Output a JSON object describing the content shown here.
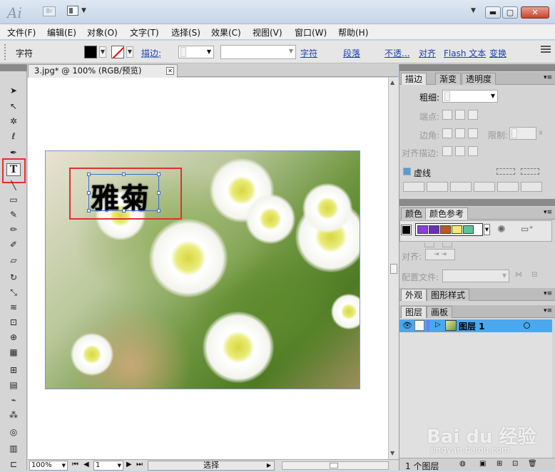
{
  "app": {
    "logo": "Ai",
    "bridge_label": "Br",
    "window_buttons": {
      "minimize": "▬",
      "maximize": "▢",
      "close": "✕"
    }
  },
  "menu": [
    "文件(F)",
    "编辑(E)",
    "对象(O)",
    "文字(T)",
    "选择(S)",
    "效果(C)",
    "视图(V)",
    "窗口(W)",
    "帮助(H)"
  ],
  "control_bar": {
    "mode_label": "字符",
    "stroke_label": "描边:",
    "links": [
      "字符",
      "段落",
      "不透...",
      "对齐",
      "Flash 文本",
      "变换"
    ]
  },
  "document": {
    "tab_title": "3.jpg* @ 100% (RGB/预览)",
    "artwork_text": "雅菊"
  },
  "status_bar": {
    "zoom": "100%",
    "page": "1",
    "tool": "选择"
  },
  "stroke_panel": {
    "tabs": [
      "描边",
      "渐变",
      "透明度"
    ],
    "weight_label": "粗细:",
    "cap_label": "端点:",
    "corner_label": "边角:",
    "limit_label": "限制:",
    "align_label": "对齐描边:",
    "dashed_label": "虚线",
    "limit_unit": "x"
  },
  "color_panel": {
    "tabs": [
      "颜色",
      "颜色参考"
    ],
    "align_label": "对齐:",
    "profile_label": "配置文件:",
    "harmony_colors": [
      "#8a3fd8",
      "#6a2fb8",
      "#c0571e",
      "#f2ea72",
      "#59c596"
    ]
  },
  "appearance_panel": {
    "tabs": [
      "外观",
      "图形样式"
    ]
  },
  "layers_panel": {
    "tabs": [
      "图层",
      "画板"
    ],
    "layer_name": "图层 1",
    "count_label": "1 个图层"
  },
  "watermark": {
    "logo": "Bai du 经验",
    "url": "jingyan.baidu.com"
  }
}
